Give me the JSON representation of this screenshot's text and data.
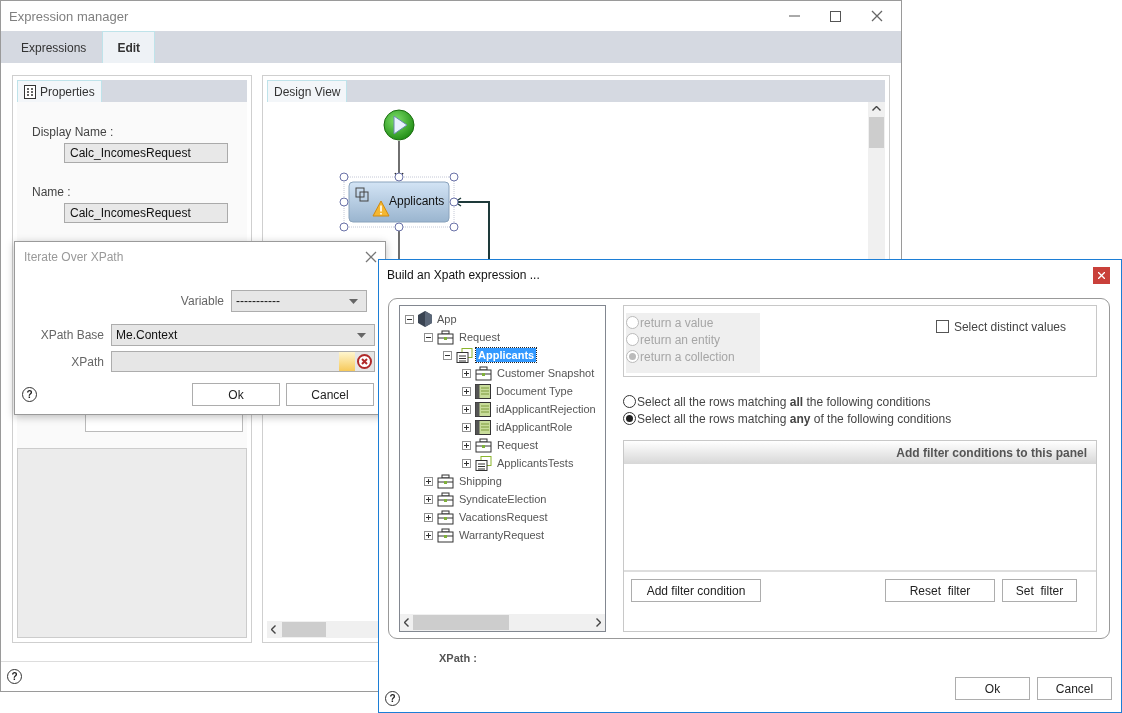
{
  "main_window": {
    "title": "Expression manager",
    "help": "?",
    "tabs": [
      {
        "label": "Expressions",
        "selected": false
      },
      {
        "label": "Edit",
        "selected": true
      }
    ],
    "properties_panel": {
      "tab": "Properties",
      "fields": [
        {
          "label": "Display Name :",
          "value": "Calc_IncomesRequest"
        },
        {
          "label": "Name :",
          "value": "Calc_IncomesRequest"
        }
      ]
    },
    "design_view": {
      "tab": "Design View",
      "node": {
        "label": "Applicants",
        "selected": true,
        "warning": true
      }
    }
  },
  "iterate_dialog": {
    "title": "Iterate Over XPath",
    "help": "?",
    "variable": {
      "label": "Variable",
      "value": "-----------"
    },
    "xpath_base": {
      "label": "XPath Base",
      "value": "Me.Context"
    },
    "xpath": {
      "label": "XPath"
    },
    "buttons": [
      "Ok",
      "Cancel"
    ]
  },
  "xpath_dialog": {
    "title": "Build an Xpath expression ...",
    "help": "?",
    "tree": [
      {
        "label": "App",
        "kind": "app",
        "expanded": true,
        "selected": false,
        "children": [
          {
            "label": "Request",
            "kind": "entity",
            "expanded": true,
            "selected": false,
            "children": [
              {
                "label": "Applicants",
                "kind": "collection",
                "expanded": true,
                "selected": true,
                "children": [
                  {
                    "label": "Customer Snapshot",
                    "kind": "entity",
                    "expanded": false,
                    "selected": false
                  },
                  {
                    "label": "Document Type",
                    "kind": "table",
                    "expanded": false,
                    "selected": false
                  },
                  {
                    "label": "idApplicantRejection",
                    "kind": "table",
                    "expanded": false,
                    "selected": false
                  },
                  {
                    "label": "idApplicantRole",
                    "kind": "table",
                    "expanded": false,
                    "selected": false
                  },
                  {
                    "label": "Request",
                    "kind": "entity",
                    "expanded": false,
                    "selected": false
                  },
                  {
                    "label": "ApplicantsTests",
                    "kind": "collection",
                    "expanded": false,
                    "selected": false
                  }
                ]
              }
            ]
          },
          {
            "label": "Shipping",
            "kind": "entity",
            "expanded": false,
            "selected": false
          },
          {
            "label": "SyndicateElection",
            "kind": "entity",
            "expanded": false,
            "selected": false
          },
          {
            "label": "VacationsRequest",
            "kind": "entity",
            "expanded": false,
            "selected": false
          },
          {
            "label": "WarrantyRequest",
            "kind": "entity",
            "expanded": false,
            "selected": false
          }
        ]
      }
    ],
    "return_options": [
      {
        "label": "return a value",
        "selected": false,
        "disabled": true
      },
      {
        "label": "return an entity",
        "selected": false,
        "disabled": true
      },
      {
        "label": "return a collection",
        "selected": true,
        "disabled": true
      }
    ],
    "distinct": {
      "label": "Select distinct values",
      "checked": false
    },
    "match_options": [
      {
        "label": "Select all the rows matching **all** the following conditions",
        "selected": false
      },
      {
        "label": "Select all the rows matching **any** of the following conditions",
        "selected": true
      }
    ],
    "filter_panel": {
      "header": "Add filter conditions to this panel",
      "add_button": "Add filter condition",
      "buttons": [
        "Reset  filter",
        "Set  filter"
      ]
    },
    "xpath_label": "XPath :",
    "buttons": [
      "Ok",
      "Cancel"
    ]
  }
}
